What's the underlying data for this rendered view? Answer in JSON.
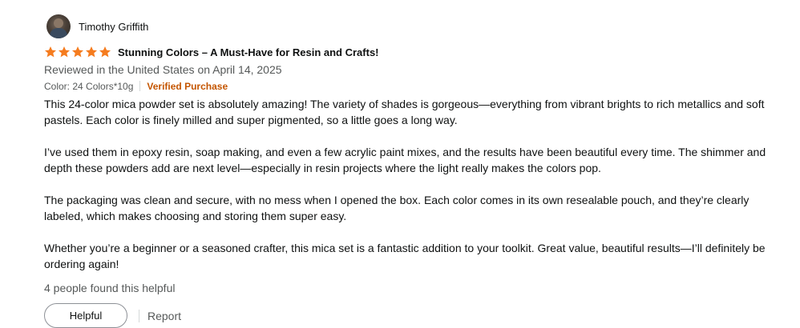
{
  "review": {
    "reviewer_name": "Timothy Griffith",
    "rating": 5,
    "rating_max": 5,
    "title": "Stunning Colors – A Must-Have for Resin and Crafts!",
    "date_line": "Reviewed in the United States on April 14, 2025",
    "variant": "Color: 24 Colors*10g",
    "verified_label": "Verified Purchase",
    "body": [
      "This 24-color mica powder set is absolutely amazing! The variety of shades is gorgeous—everything from vibrant brights to rich metallics and soft pastels. Each color is finely milled and super pigmented, so a little goes a long way.",
      "I’ve used them in epoxy resin, soap making, and even a few acrylic paint mixes, and the results have been beautiful every time. The shimmer and depth these powders add are next level—especially in resin projects where the light really makes the colors pop.",
      "The packaging was clean and secure, with no mess when I opened the box. Each color comes in its own resealable pouch, and they’re clearly labeled, which makes choosing and storing them super easy.",
      "Whether you’re a beginner or a seasoned crafter, this mica set is a fantastic addition to your toolkit. Great value, beautiful results—I’ll definitely be ordering again!"
    ],
    "helpful_count_text": "4 people found this helpful"
  },
  "actions": {
    "helpful_label": "Helpful",
    "report_label": "Report"
  },
  "colors": {
    "star": "#f57c1f",
    "verified": "#c45500",
    "secondary_text": "#565959"
  },
  "icons": {
    "star": "star-icon"
  }
}
